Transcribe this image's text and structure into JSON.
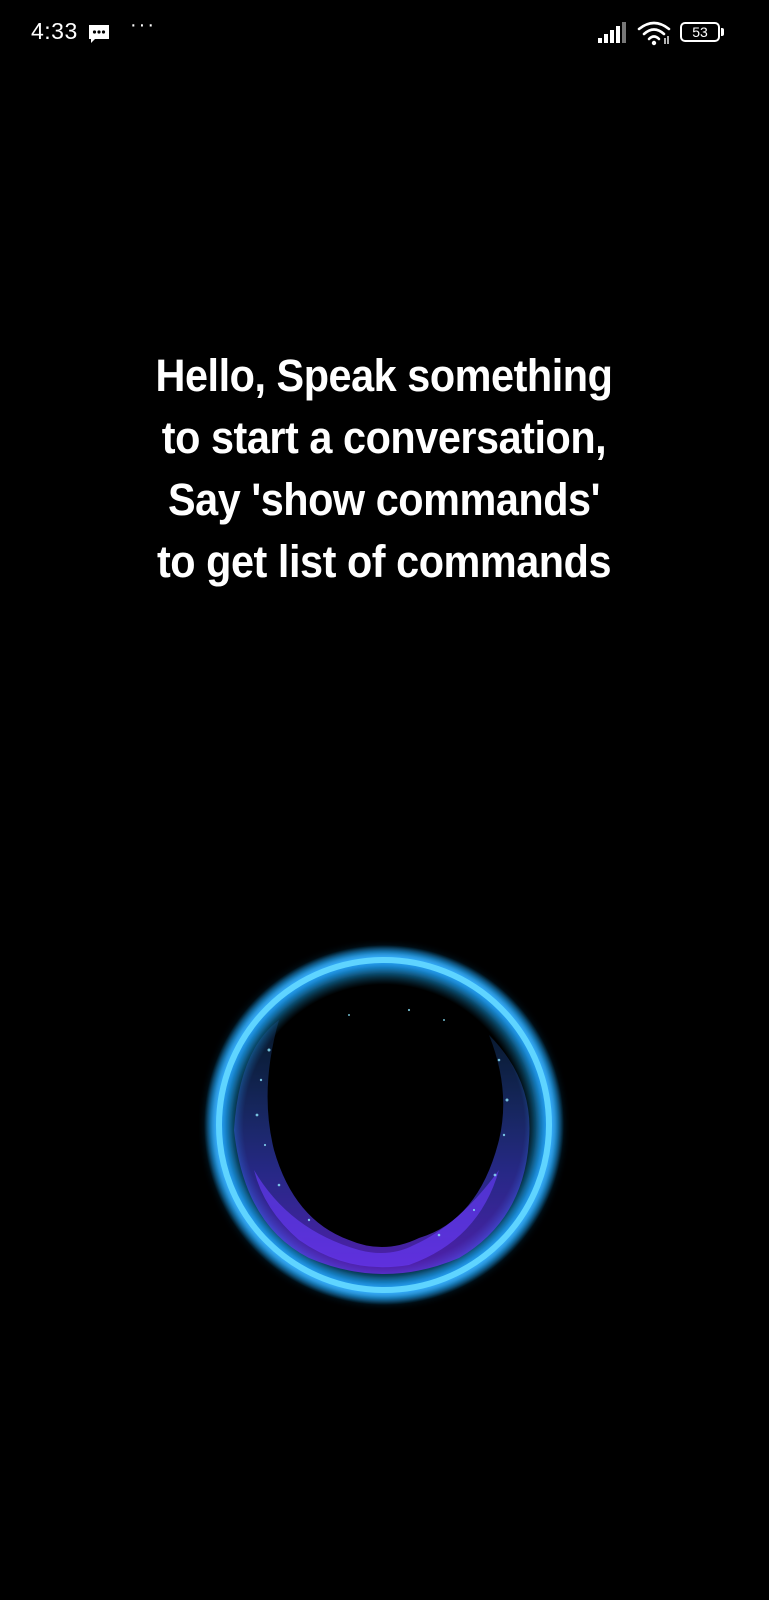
{
  "status_bar": {
    "time": "4:33",
    "more_indicator": "···",
    "battery_level": "53",
    "icons": [
      "message-icon",
      "signal-icon",
      "wifi-icon",
      "battery-icon"
    ]
  },
  "assistant": {
    "prompt": "Hello, Speak something to start a conversation, Say 'show commands' to get list of commands"
  },
  "colors": {
    "background": "#000000",
    "orb_ring": "#1fb6ff",
    "orb_wave": "#5a3cff"
  }
}
